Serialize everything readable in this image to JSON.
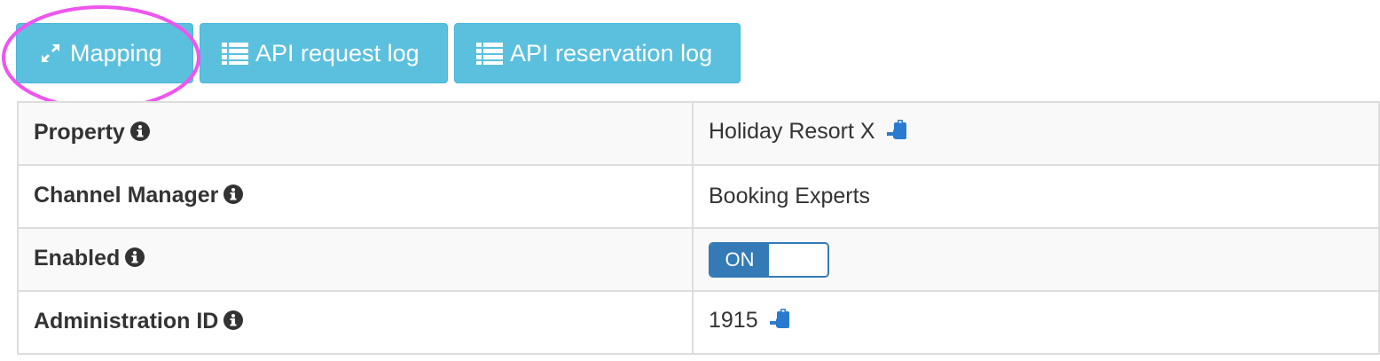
{
  "toolbar": {
    "mapping_label": "Mapping",
    "api_request_log_label": "API request log",
    "api_reservation_log_label": "API reservation log"
  },
  "colors": {
    "button_info": "#5bc0de",
    "primary": "#337ab7",
    "highlight_ring": "#ee55ee"
  },
  "rows": [
    {
      "label": "Property",
      "value": "Holiday Resort X"
    },
    {
      "label": "Channel Manager",
      "value": "Booking Experts"
    },
    {
      "label": "Enabled",
      "toggle": "ON"
    },
    {
      "label": "Administration ID",
      "value": "1915"
    }
  ]
}
